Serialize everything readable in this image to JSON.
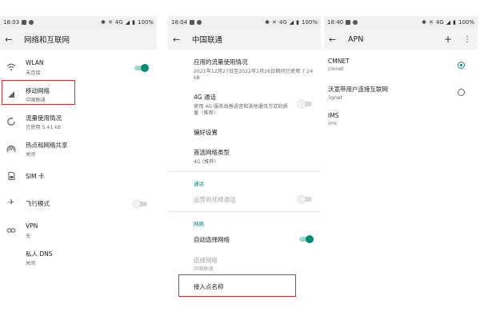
{
  "colors": {
    "accent": "#00897b",
    "highlight_box": "#d63131"
  },
  "screen1": {
    "status": {
      "time": "18:03",
      "battery": "100%",
      "signal": "4G"
    },
    "title": "网络和互联网",
    "items": [
      {
        "icon": "wifi-icon",
        "title": "WLAN",
        "subtitle": "未连接",
        "toggle": "on"
      },
      {
        "icon": "cellular-signal-icon",
        "title": "移动网络",
        "subtitle": "中国联通"
      },
      {
        "icon": "data-usage-icon",
        "title": "流量使用情况",
        "subtitle": "已使用 5.41 kB"
      },
      {
        "icon": "hotspot-icon",
        "title": "热点和网络共享",
        "subtitle": "关闭"
      },
      {
        "icon": "sim-card-icon",
        "title": "SIM 卡",
        "subtitle": ""
      },
      {
        "icon": "airplane-icon",
        "title": "飞行模式",
        "subtitle": "",
        "toggle": "off"
      },
      {
        "icon": "vpn-key-icon",
        "title": "VPN",
        "subtitle": "无"
      },
      {
        "icon": "private-dns-icon",
        "title": "私人 DNS",
        "subtitle": "关闭"
      }
    ]
  },
  "screen2": {
    "status": {
      "time": "18:04",
      "battery": "100%",
      "signal": "4G"
    },
    "title": "中国联通",
    "usage": {
      "title": "应用的流量使用情况",
      "subtitle": "2021年12月27日至2022年1月26日期间已使用 7.24 kB"
    },
    "volte": {
      "title": "4G 通话",
      "subtitle": "使用 4G 服务改善语音和其他通讯方式的质量（推荐）",
      "toggle": "off"
    },
    "preferences": {
      "title": "偏好设置"
    },
    "network_type": {
      "title": "首选网络类型",
      "subtitle": "4G (推荐)"
    },
    "calls_section": "通话",
    "video_calls": {
      "title": "运营商视频通话",
      "toggle": "off"
    },
    "network_section": "网络",
    "auto_select": {
      "title": "自动选择网络",
      "toggle": "on"
    },
    "select_network": {
      "title": "选择网络",
      "subtitle": "中国联通"
    },
    "apn": {
      "title": "接入点名称"
    }
  },
  "screen3": {
    "status": {
      "time": "18:40",
      "battery": "100%",
      "signal": "4G"
    },
    "title": "APN",
    "add_label": "+",
    "more_label": "⋮",
    "apns": [
      {
        "name": "CMNET",
        "value": "cmnet",
        "selected": true
      },
      {
        "name": "沃宽带用户连接互联网",
        "value": "3gnet",
        "selected": false
      },
      {
        "name": "IMS",
        "value": "ims",
        "selected": null
      }
    ]
  }
}
